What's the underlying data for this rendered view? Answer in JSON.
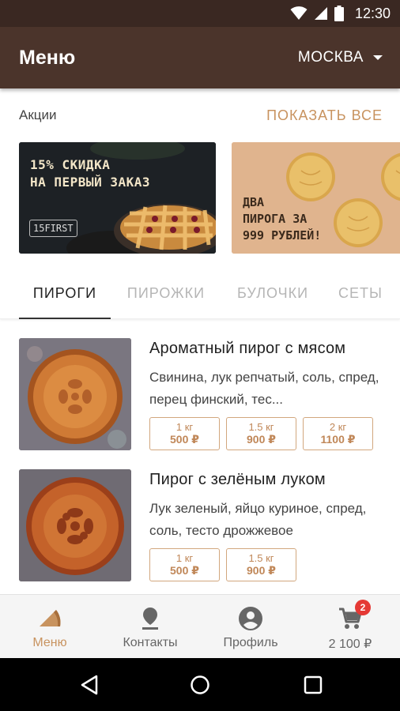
{
  "status_bar": {
    "time": "12:30",
    "icons": [
      "wifi-icon",
      "signal-icon",
      "battery-icon"
    ]
  },
  "app_bar": {
    "title": "Меню",
    "city": "МОСКВА"
  },
  "promos": {
    "label": "Акции",
    "show_all": "ПОКАЗАТЬ ВСЕ",
    "banners": [
      {
        "line1": "15% СКИДКА",
        "line2": "НА ПЕРВЫЙ ЗАКАЗ",
        "code": "15FIRST"
      },
      {
        "line1": "ДВА",
        "line2": "ПИРОГА ЗА",
        "line3": "999 РУБЛЕЙ!"
      }
    ]
  },
  "tabs": [
    {
      "label": "ПИРОГИ",
      "active": true
    },
    {
      "label": "ПИРОЖКИ",
      "active": false
    },
    {
      "label": "БУЛОЧКИ",
      "active": false
    },
    {
      "label": "СЕТЫ",
      "active": false
    }
  ],
  "products": [
    {
      "title": "Ароматный пирог с мясом",
      "description": "Свинина, лук репчатый, соль, спред, перец финский, тес...",
      "sizes": [
        {
          "weight": "1 кг",
          "price": "500 ₽"
        },
        {
          "weight": "1.5 кг",
          "price": "900 ₽"
        },
        {
          "weight": "2 кг",
          "price": "1100 ₽"
        }
      ]
    },
    {
      "title": "Пирог с зелёным луком",
      "description": "Лук зеленый, яйцо куриное, спред, соль, тесто дрожжевое",
      "sizes": [
        {
          "weight": "1 кг",
          "price": "500 ₽"
        },
        {
          "weight": "1.5 кг",
          "price": "900 ₽"
        }
      ]
    }
  ],
  "bottom_nav": [
    {
      "label": "Меню",
      "icon": "pie-slice-icon",
      "active": true
    },
    {
      "label": "Контакты",
      "icon": "location-pin-icon",
      "active": false
    },
    {
      "label": "Профиль",
      "icon": "profile-icon",
      "active": false
    },
    {
      "label": "2 100 ₽",
      "icon": "cart-icon",
      "badge": "2",
      "active": false
    }
  ],
  "colors": {
    "app_bar": "#4b342b",
    "status_bar": "#3a2822",
    "accent": "#c8935f",
    "badge": "#e53935"
  }
}
